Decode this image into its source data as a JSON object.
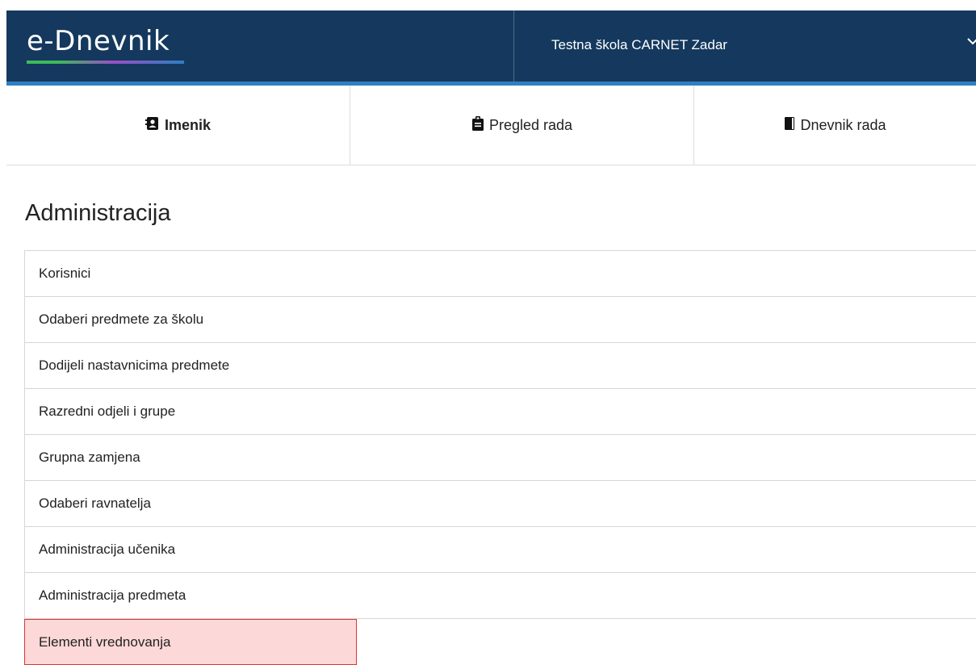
{
  "header": {
    "logo_text": "e-Dnevnik",
    "school_name": "Testna škola CARNET Zadar",
    "chevron_icon": "chevron-down-icon"
  },
  "tabs": [
    {
      "label": "Imenik",
      "icon": "address-book-icon"
    },
    {
      "label": "Pregled rada",
      "icon": "clipboard-icon"
    },
    {
      "label": "Dnevnik rada",
      "icon": "book-icon"
    }
  ],
  "page_title": "Administracija",
  "menu": [
    {
      "label": "Korisnici"
    },
    {
      "label": "Odaberi predmete za školu"
    },
    {
      "label": "Dodijeli nastavnicima predmete"
    },
    {
      "label": "Razredni odjeli i grupe"
    },
    {
      "label": "Grupna zamjena"
    },
    {
      "label": "Odaberi ravnatelja"
    },
    {
      "label": "Administracija učenika"
    },
    {
      "label": "Administracija predmeta"
    },
    {
      "label": "Elementi vrednovanja"
    }
  ],
  "colors": {
    "header_bg": "#15395e",
    "header_accent": "#2f7fc1",
    "highlight_bg": "#fdd8d8",
    "highlight_border": "#d93636"
  }
}
